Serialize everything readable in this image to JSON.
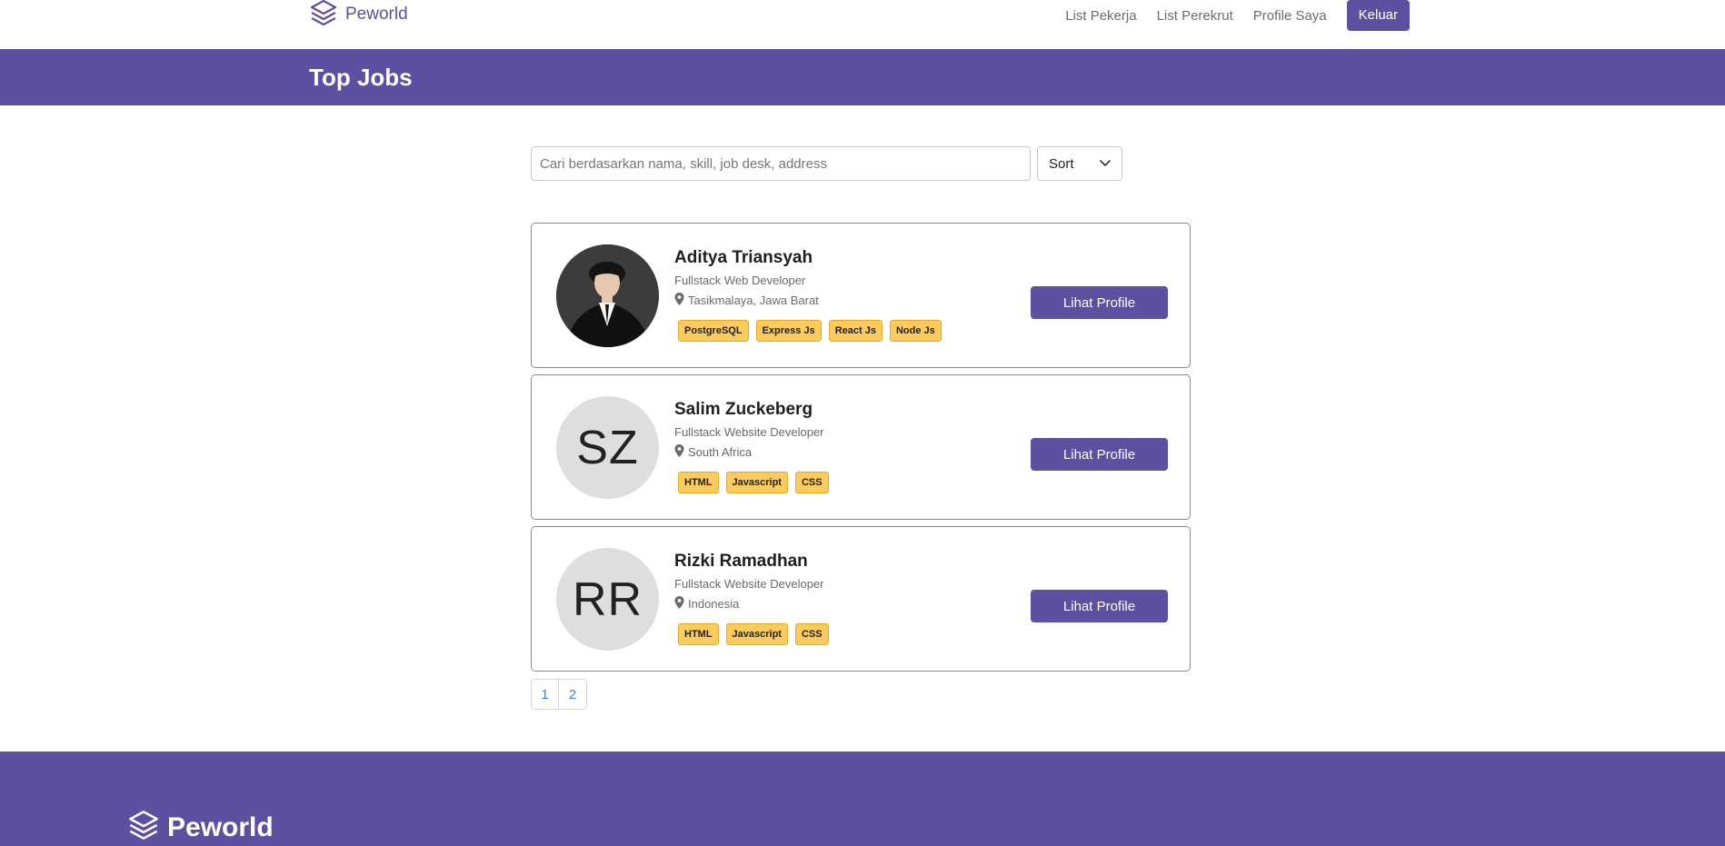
{
  "navbar": {
    "brand": "Peworld",
    "links": [
      "List Pekerja",
      "List Perekrut",
      "Profile Saya"
    ],
    "logout_label": "Keluar"
  },
  "banner": {
    "title": "Top Jobs"
  },
  "search": {
    "placeholder": "Cari berdasarkan nama, skill, job desk, address",
    "value": ""
  },
  "sort": {
    "label": "Sort"
  },
  "workers": [
    {
      "name": "Aditya Triansyah",
      "role": "Fullstack Web Developer",
      "location": "Tasikmalaya, Jawa Barat",
      "skills": [
        "PostgreSQL",
        "Express Js",
        "React Js",
        "Node Js"
      ],
      "avatar": "photo",
      "button": "Lihat Profile"
    },
    {
      "name": "Salim Zuckeberg",
      "role": "Fullstack Website Developer",
      "location": "South Africa",
      "skills": [
        "HTML",
        "Javascript",
        "CSS"
      ],
      "avatar": "SZ",
      "button": "Lihat Profile"
    },
    {
      "name": "Rizki Ramadhan",
      "role": "Fullstack Website Developer",
      "location": "Indonesia",
      "skills": [
        "HTML",
        "Javascript",
        "CSS"
      ],
      "avatar": "RR",
      "button": "Lihat Profile"
    }
  ],
  "pagination": {
    "pages": [
      "1",
      "2"
    ]
  },
  "footer": {
    "brand": "Peworld"
  },
  "colors": {
    "primary": "#5e50a1",
    "skill_badge": "#fbcb5e",
    "link": "#3a7ed6"
  },
  "icons": {
    "logo": "layers-icon",
    "sort": "chevron-down-icon",
    "location": "map-pin-icon"
  }
}
